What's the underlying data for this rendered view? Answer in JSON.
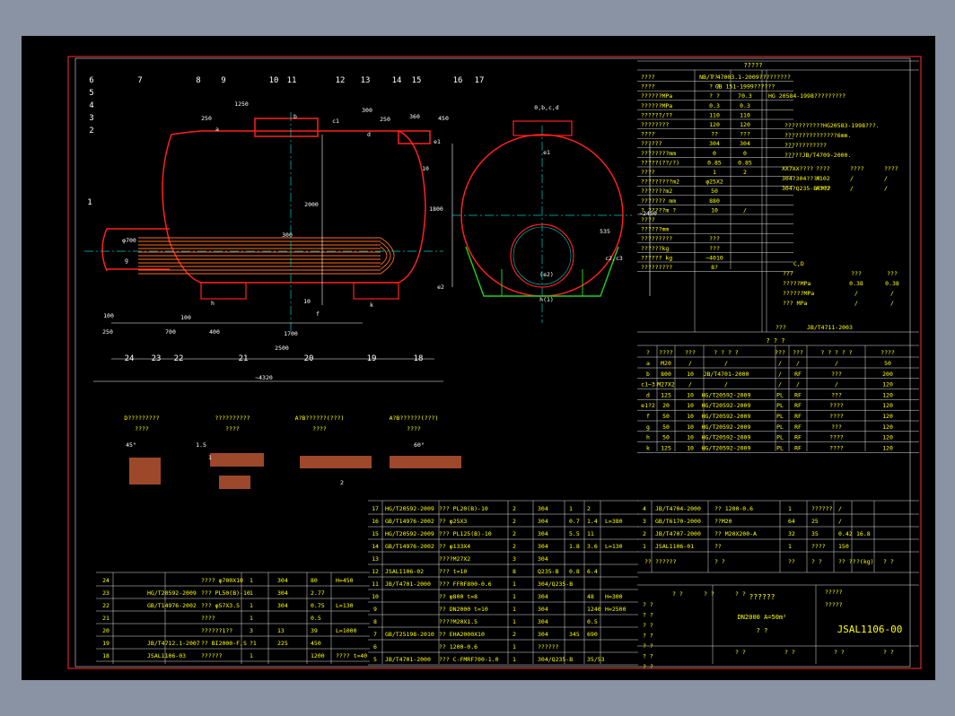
{
  "design_data": {
    "title": "?????",
    "rows": [
      [
        "????",
        "??",
        "NB/T 47003.1-2009?????????"
      ],
      [
        "????",
        "? ?",
        "GB 151-1999??????"
      ],
      [
        "??????MPa",
        "? ?",
        "70.3",
        "HG 20584-1998?????????"
      ],
      [
        "??????MPa",
        "0.3",
        "0.3"
      ],
      [
        "??????/??",
        "110",
        "110"
      ],
      [
        "????????",
        "120",
        "120"
      ],
      [
        "????",
        "??",
        "???"
      ],
      [
        "??????",
        "304",
        "304"
      ],
      [
        "????????mm",
        "0",
        "0"
      ],
      [
        "?????(??/?)",
        "0.85",
        "0.85"
      ],
      [
        "????",
        "1",
        "2"
      ],
      [
        "?????????m2",
        "φ25X2"
      ],
      [
        "???????m2",
        "50"
      ],
      [
        "???????  mm",
        "880"
      ],
      [
        "? ?????m  ?",
        "10",
        "/"
      ],
      [
        "????"
      ],
      [
        "??????mm"
      ],
      [
        "?????????",
        "???"
      ],
      [
        "??????kg",
        "???"
      ],
      [
        "??????  kg",
        "~4010"
      ],
      [
        "?????????",
        "8?"
      ]
    ],
    "notes": [
      "???????????HG20583-1998???.",
      "???????????????6mm.",
      "????????????",
      "?????JB/T4709-2000."
    ],
    "material_rows": [
      [
        "XX7XX????",
        "????",
        "????",
        "????"
      ],
      [
        "304?304????",
        "A102",
        "/",
        "/"
      ],
      [
        "304?Q235-B????",
        "A302",
        "/",
        "/"
      ]
    ],
    "cd_label": "C,D",
    "test_rows": [
      [
        "???",
        "???",
        "???"
      ],
      [
        "?????MPa",
        "0.38",
        "0.38"
      ],
      [
        "??????MPa",
        "/",
        "/"
      ],
      [
        "??? MPa",
        "/",
        "/"
      ]
    ],
    "std_row": [
      "???",
      "JB/T4711-2003"
    ]
  },
  "nozzle_table": {
    "title": "?    ?    ?",
    "header": [
      "?",
      "????",
      "???",
      "? ? ? ?",
      "???",
      "???",
      "? ? ? ? ?",
      "????"
    ],
    "rows": [
      [
        "a",
        "M20",
        "/",
        "/",
        "/",
        "/",
        "/",
        "50"
      ],
      [
        "b",
        "800",
        "10",
        "JB/T4701-2000",
        "/",
        "RF",
        "???",
        "200"
      ],
      [
        "c1~3",
        "M27X2",
        "/",
        "/",
        "/",
        "/",
        "/",
        "120"
      ],
      [
        "d",
        "125",
        "10",
        "HG/T20592-2009",
        "PL",
        "RF",
        "???",
        "120"
      ],
      [
        "e1?2",
        "20",
        "10",
        "HG/T20592-2009",
        "PL",
        "RF",
        "????",
        "120"
      ],
      [
        "f",
        "50",
        "10",
        "HG/T20592-2009",
        "PL",
        "RF",
        "????",
        "120"
      ],
      [
        "g",
        "50",
        "10",
        "HG/T20592-2009",
        "PL",
        "RF",
        "???",
        "120"
      ],
      [
        "h",
        "50",
        "10",
        "HG/T20592-2009",
        "PL",
        "RF",
        "????",
        "120"
      ],
      [
        "k",
        "125",
        "10",
        "HG/T20592-2009",
        "PL",
        "RF",
        "????",
        "120"
      ]
    ]
  },
  "drawing": {
    "balloons": [
      "6",
      "5",
      "4",
      "3",
      "2",
      "7",
      "8",
      "9",
      "10",
      "11",
      "12",
      "13",
      "14",
      "15",
      "16",
      "17",
      "1",
      "24",
      "23",
      "22",
      "21",
      "20",
      "19",
      "18"
    ],
    "dims": [
      "1250",
      "250",
      "300",
      "250",
      "450",
      "360",
      "2000",
      "1800",
      "10",
      "100",
      "250",
      "700",
      "400",
      "100",
      "1700",
      "2500",
      "~4320",
      "φ700",
      "300",
      "~2450",
      "535",
      "10"
    ],
    "labels": [
      "a",
      "b",
      "c1",
      "d",
      "e1",
      "e2",
      "c2,c3",
      "f",
      "k",
      "g",
      "h",
      "h(1)",
      "(e2)",
      "e1",
      "0,b,c,d"
    ],
    "detail_titles": [
      [
        "D?????????",
        "????"
      ],
      [
        "??????????",
        "????"
      ],
      [
        "A?B??????(???)",
        "????"
      ],
      [
        "A?B??????(???)",
        "????"
      ]
    ],
    "detail_dims": [
      "45°",
      "1.5",
      "1",
      "60°",
      "2"
    ]
  },
  "bom_left": {
    "rows": [
      [
        "24",
        "",
        "???? φ700X10",
        "1",
        "304",
        "80",
        "H=450"
      ],
      [
        "23",
        "HG/T20592-2009",
        "??? PL50(B)-10",
        "1",
        "304",
        "2.77",
        ""
      ],
      [
        "22",
        "GB/T14976-2002",
        "??? φ57X3.5",
        "1",
        "304",
        "0.75",
        "L=130"
      ],
      [
        "21",
        "",
        "????",
        "1",
        "",
        "0.5",
        ""
      ],
      [
        "20",
        "",
        "??????1??",
        "3",
        "13",
        "39",
        "L=1000"
      ],
      [
        "19",
        "JB/T4712.1-2007",
        "?? BI2000-F,S",
        "?1",
        "225",
        "450",
        ""
      ],
      [
        "18",
        "JSAL1106-03",
        "??????",
        "1",
        "",
        "1200",
        "???? t=40"
      ]
    ]
  },
  "bom_mid": {
    "rows": [
      [
        "17",
        "HG/T20592-2009",
        "??? PL20(B)-10",
        "2",
        "304",
        "1",
        "2",
        ""
      ],
      [
        "16",
        "GB/T14976-2002",
        "?? φ25X3",
        "2",
        "304",
        "0.7",
        "1.4",
        "L=380"
      ],
      [
        "15",
        "HG/T20592-2009",
        "??? PL125(B)-10",
        "2",
        "304",
        "5.5",
        "11",
        ""
      ],
      [
        "14",
        "GB/T14976-2002",
        "?? φ133X4",
        "2",
        "304",
        "1.8",
        "3.6",
        "L=130"
      ],
      [
        "13",
        "",
        "????M27X2",
        "3",
        "304",
        "",
        "",
        ""
      ],
      [
        "12",
        "JSAL1106-02",
        "??? t=10",
        "8",
        "Q235-B",
        "0.8",
        "6.4",
        ""
      ],
      [
        "11",
        "JB/T4701-2000",
        "??? FFRF800-0.6",
        "1",
        "304/Q235-B",
        "",
        "",
        ""
      ],
      [
        "10",
        "",
        "?? φ800 t=8",
        "1",
        "304",
        "",
        "48",
        "H=300"
      ],
      [
        "9",
        "",
        "?? DN2000 t=10",
        "1",
        "304",
        "",
        "1240",
        "H=2500"
      ],
      [
        "8",
        "",
        "????M20X1.5",
        "1",
        "304",
        "",
        "0.5",
        ""
      ],
      [
        "7",
        "GB/T25198-2010",
        "?? EHA2000X10",
        "2",
        "304",
        "345",
        "690",
        ""
      ],
      [
        "6",
        "",
        "?? 1200-0.6",
        "1",
        "??????",
        "",
        "",
        ""
      ],
      [
        "5",
        "JB/T4701-2000",
        "??? C-FMRF700-1.0",
        "1",
        "304/Q235-B",
        "",
        "35/53",
        ""
      ]
    ]
  },
  "bom_right": {
    "rows": [
      [
        "4",
        "JB/T4704-2000",
        "?? 1200-0.6",
        "1",
        "??????",
        "/",
        ""
      ],
      [
        "3",
        "GB/T6170-2000",
        "??M20",
        "64",
        "25",
        "/",
        ""
      ],
      [
        "2",
        "JB/T4707-2000",
        "?? M20X200-A",
        "32",
        "35",
        "0.42",
        "16.8"
      ],
      [
        "1",
        "JSAL1106-01",
        "??",
        "1",
        "????",
        "150",
        ""
      ]
    ],
    "header": [
      "??",
      "??????",
      "?     ?",
      "??",
      "? ?",
      "?? ??",
      "?(kg)",
      "? ?"
    ]
  },
  "title_block": {
    "signers": [
      "? ?",
      "? ?",
      "? ?",
      "? ?",
      "? ?",
      "? ?",
      "? ?"
    ],
    "sign_header": [
      "?  ?",
      "?  ?",
      "? ?"
    ],
    "name": "??????",
    "spec": "DN2000   A=50m²",
    "subtitle": "?  ?",
    "project1": "?????",
    "project2": "?????",
    "drawing_no": "JSAL1106-00",
    "footer": [
      "? ?",
      "? ?",
      "?  ?",
      "?  ?"
    ]
  }
}
